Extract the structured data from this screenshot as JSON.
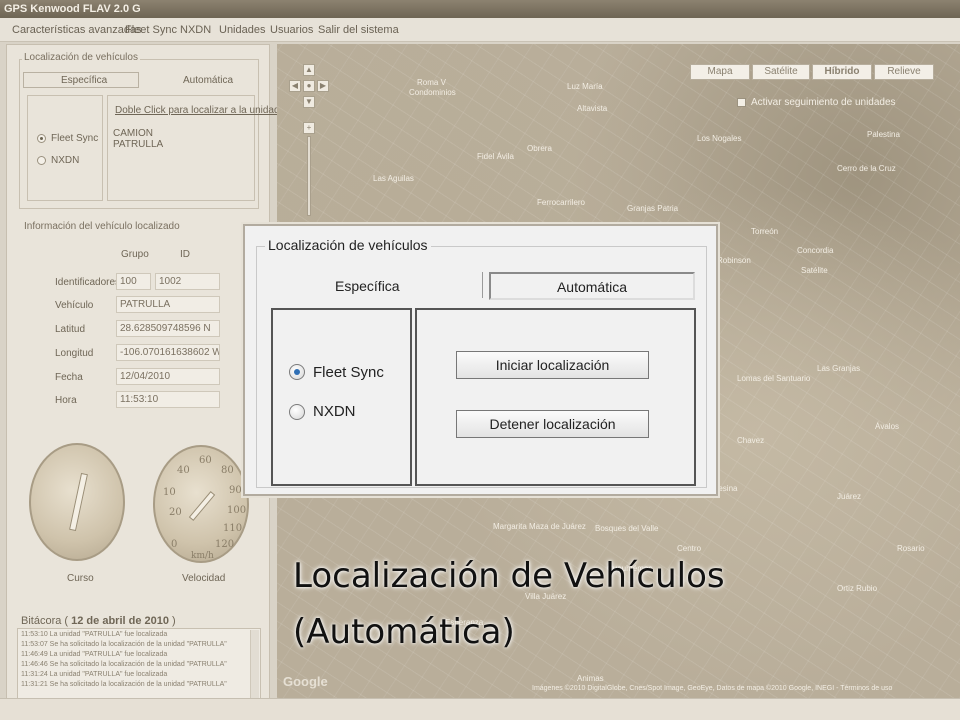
{
  "window": {
    "title": "GPS Kenwood FLAV 2.0 G"
  },
  "menu": [
    "Características avanzadas",
    "Fleet Sync",
    "NXDN",
    "Unidades",
    "Usuarios",
    "Salir del sistema"
  ],
  "left_panel": {
    "localization": {
      "title": "Localización de vehículos",
      "tabs": [
        "Específica",
        "Automática"
      ],
      "radios": [
        {
          "label": "Fleet Sync",
          "selected": true
        },
        {
          "label": "NXDN",
          "selected": false
        }
      ],
      "link": "Doble Click para localizar a la unidad",
      "units": [
        "CAMION",
        "PATRULLA"
      ]
    },
    "vehicle_info": {
      "title": "Información del vehículo localizado",
      "col_group": "Grupo",
      "col_id": "ID",
      "identificadores_label": "Identificadores",
      "grupo_value": "100",
      "id_value": "1002",
      "vehiculo_label": "Vehículo",
      "vehiculo_value": "PATRULLA",
      "latitud_label": "Latitud",
      "latitud_value": "28.628509748596 N",
      "longitud_label": "Longitud",
      "longitud_value": "-106.070161638602 W",
      "fecha_label": "Fecha",
      "fecha_value": "12/04/2010",
      "hora_label": "Hora",
      "hora_value": "11:53:10"
    },
    "gauges": {
      "curso_label": "Curso",
      "velocidad_label": "Velocidad",
      "speed_unit": "km/h",
      "speed_ticks": [
        "20",
        "40",
        "60",
        "80",
        "90",
        "100",
        "110",
        "120",
        "0",
        "10"
      ]
    },
    "bitacora": {
      "title": "Bitácora",
      "date": "12 de abril de 2010",
      "entries": [
        "11:53:10 La unidad \"PATRULLA\" fue localizada",
        "11:53:07 Se ha solicitado la localización de la unidad \"PATRULLA\"",
        "11:46:49 La unidad \"PATRULLA\" fue localizada",
        "11:46:46 Se ha solicitado la localización de la unidad \"PATRULLA\"",
        "11:31:24 La unidad \"PATRULLA\" fue localizada",
        "11:31:21 Se ha solicitado la localización de la unidad \"PATRULLA\""
      ]
    }
  },
  "map": {
    "buttons": [
      "Mapa",
      "Satélite",
      "Híbrido",
      "Relieve"
    ],
    "active_button": "Híbrido",
    "tracking_checkbox": "Activar seguimiento de unidades",
    "labels": [
      "Roma V",
      "Condominios",
      "Luz María",
      "Ferrocarrilero",
      "Fidel Ávila",
      "Palestina",
      "Cerro de la Cruz",
      "Los Nogales",
      "Torreón",
      "Robinson",
      "Concordia",
      "Satélite",
      "Lomas del Santuario",
      "Margarita Maza de Juárez",
      "Bosques del Valle",
      "Ávalos",
      "Juárez",
      "Chavez",
      "Esperanza",
      "Animas",
      "Granjas Patria",
      "Las Aguilas",
      "Obrera",
      "Cuauhtémoc",
      "Rosario",
      "Ortiz Rubio",
      "Villa Juárez",
      "Las Granjas",
      "Campesina",
      "Altavista",
      "Centro"
    ],
    "attribution": "Imágenes ©2010 DigitalGlobe, Cnes/Spot Image, GeoEye, Datos de mapa ©2010 Google, INEGI - Términos de uso"
  },
  "zoom_dialog": {
    "title": "Localización de vehículos",
    "tab_especifica": "Específica",
    "tab_automatica": "Automática",
    "radio_fleet": "Fleet Sync",
    "radio_nxdn": "NXDN",
    "btn_start": "Iniciar localización",
    "btn_stop": "Detener localización"
  },
  "caption": {
    "line1": "Localización de Vehículos",
    "line2": "(Automática)"
  }
}
